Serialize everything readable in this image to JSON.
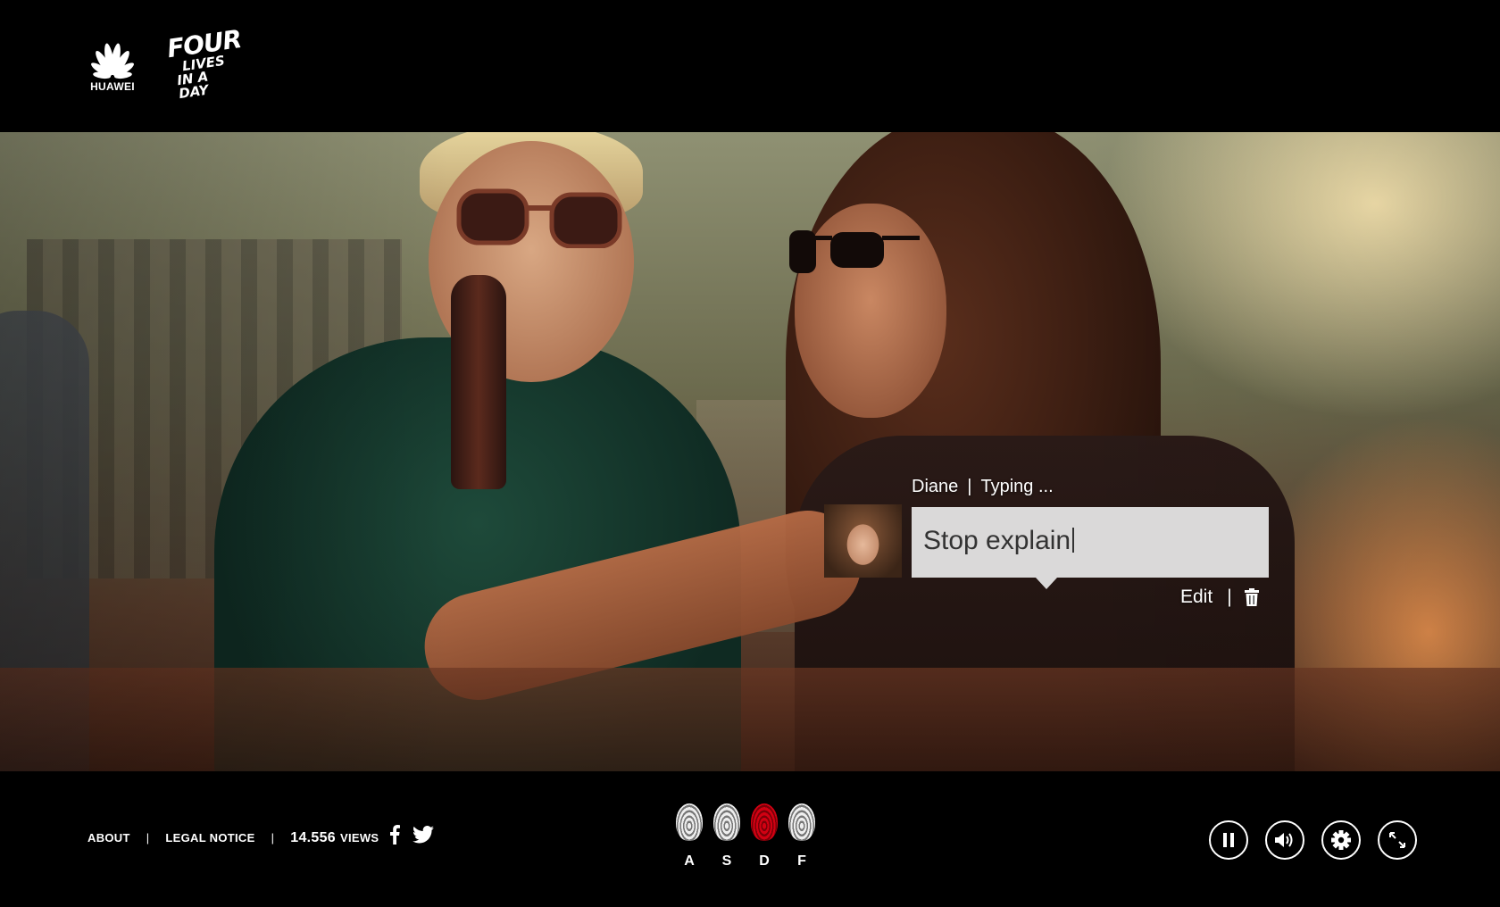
{
  "brand": {
    "huawei_wordmark": "HUAWEI",
    "campaign_line1": "FOUR",
    "campaign_line2": "LIVES",
    "campaign_line3": "IN A DAY"
  },
  "chat": {
    "author": "Diane",
    "separator": "|",
    "status": "Typing ...",
    "message": "Stop explain",
    "edit_label": "Edit",
    "actions_separator": "|"
  },
  "footer": {
    "about_label": "ABOUT",
    "legal_label": "LEGAL NOTICE",
    "separator": "|",
    "views_count": "14.556",
    "views_label": "VIEWS",
    "fingerprints": [
      {
        "key": "A",
        "color": "white",
        "active": false
      },
      {
        "key": "S",
        "color": "white",
        "active": false
      },
      {
        "key": "D",
        "color": "#d20012",
        "active": true
      },
      {
        "key": "F",
        "color": "white",
        "active": false
      }
    ],
    "controls": [
      "pause-icon",
      "volume-icon",
      "settings-icon",
      "fullscreen-icon"
    ]
  },
  "colors": {
    "background": "#000000",
    "active_fingerprint": "#d20012",
    "message_box": "#e8e8e8"
  }
}
